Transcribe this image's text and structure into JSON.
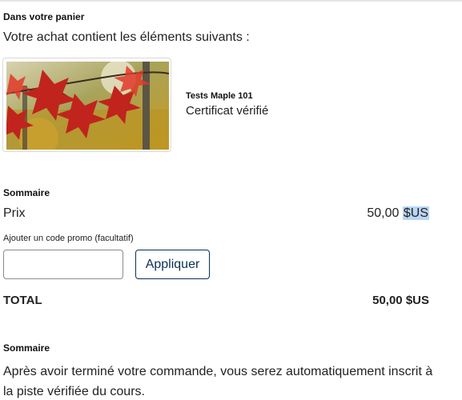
{
  "cart": {
    "heading": "Dans votre panier",
    "intro": "Votre achat contient les éléments suivants :",
    "item": {
      "image_icon": "autumn-maple-leaves-image",
      "course_name": "Tests Maple 101",
      "mode": "Certificat vérifié"
    }
  },
  "summary": {
    "heading": "Sommaire",
    "price_label": "Prix",
    "price_amount": "50,00",
    "price_currency": "$US",
    "promo_label": "Ajouter un code promo (facultatif)",
    "promo_value": "",
    "apply_label": "Appliquer",
    "total_label": "TOTAL",
    "total_value": "50,00 $US"
  },
  "info": {
    "heading": "Sommaire",
    "text": "Après avoir terminé votre commande, vous serez automatiquement inscrit à la piste vérifiée du cours."
  },
  "colors": {
    "button_border": "#0a3055",
    "selection_highlight": "#b9d6f5"
  }
}
